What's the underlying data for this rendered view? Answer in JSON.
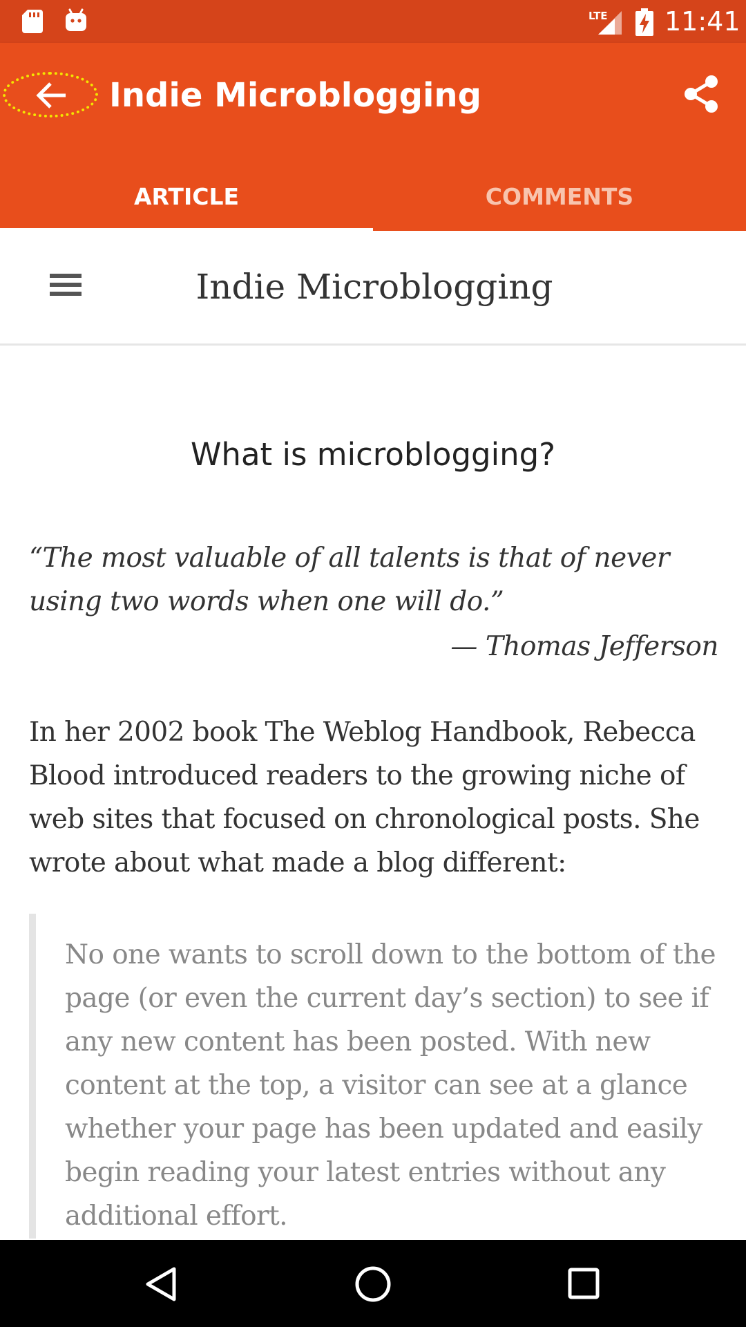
{
  "status_bar": {
    "time": "11:41",
    "network": "LTE",
    "icons": [
      "sd-card-icon",
      "android-icon",
      "signal-icon",
      "battery-charging-icon"
    ]
  },
  "app_bar": {
    "title": "Indie Microblogging",
    "back_icon": "arrow-back-icon",
    "share_icon": "share-icon",
    "background": "#e84e1c",
    "tabs": [
      {
        "label": "ARTICLE",
        "selected": true
      },
      {
        "label": "COMMENTS",
        "selected": false
      }
    ]
  },
  "page": {
    "menu_icon": "hamburger-menu-icon",
    "site_title": "Indie Microblogging",
    "heading": "What is microblogging?",
    "epigraph": {
      "quote": "“The most valuable of all talents is that of never using two words when one will do.”",
      "attribution": "— Thomas Jefferson"
    },
    "paragraph": "In her 2002 book The Weblog Handbook, Rebecca Blood introduced readers to the growing niche of web sites that focused on chronological posts. She wrote about what made a blog different:",
    "blockquote": "No one wants to scroll down to the bottom of the page (or even the current day’s section) to see if any new content has been posted. With new content at the top, a visitor can see at a glance whether your page has been updated and easily begin reading your latest entries without any additional effort."
  },
  "nav_bar": {
    "buttons": [
      "back-triangle-icon",
      "home-circle-icon",
      "recents-square-icon"
    ]
  }
}
